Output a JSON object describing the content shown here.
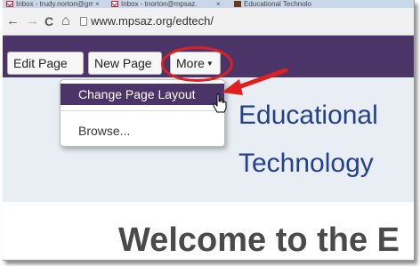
{
  "browser": {
    "tabs": [
      {
        "label": "Inbox - trudy.norton@gm",
        "icon": "gmail-icon"
      },
      {
        "label": "Inbox - tnorton@mpsaz.",
        "icon": "gmail-icon"
      },
      {
        "label": "Educational Technolo",
        "icon": "site-favicon"
      }
    ],
    "tab_close": "×",
    "back": "←",
    "forward": "→",
    "reload": "C",
    "home": "⌂",
    "url": "www.mpsaz.org/edtech/"
  },
  "toolbar": {
    "edit_page": "Edit Page",
    "new_page": "New Page",
    "more": "More",
    "caret": "▼"
  },
  "menu": {
    "items": [
      "Change Page Layout",
      "Browse..."
    ]
  },
  "page": {
    "title_line1": "Educational",
    "title_line2": "Technology",
    "welcome": "Welcome to the E"
  },
  "colors": {
    "toolbar": "#4b3468",
    "title": "#23408e",
    "annotation": "#e02020"
  }
}
